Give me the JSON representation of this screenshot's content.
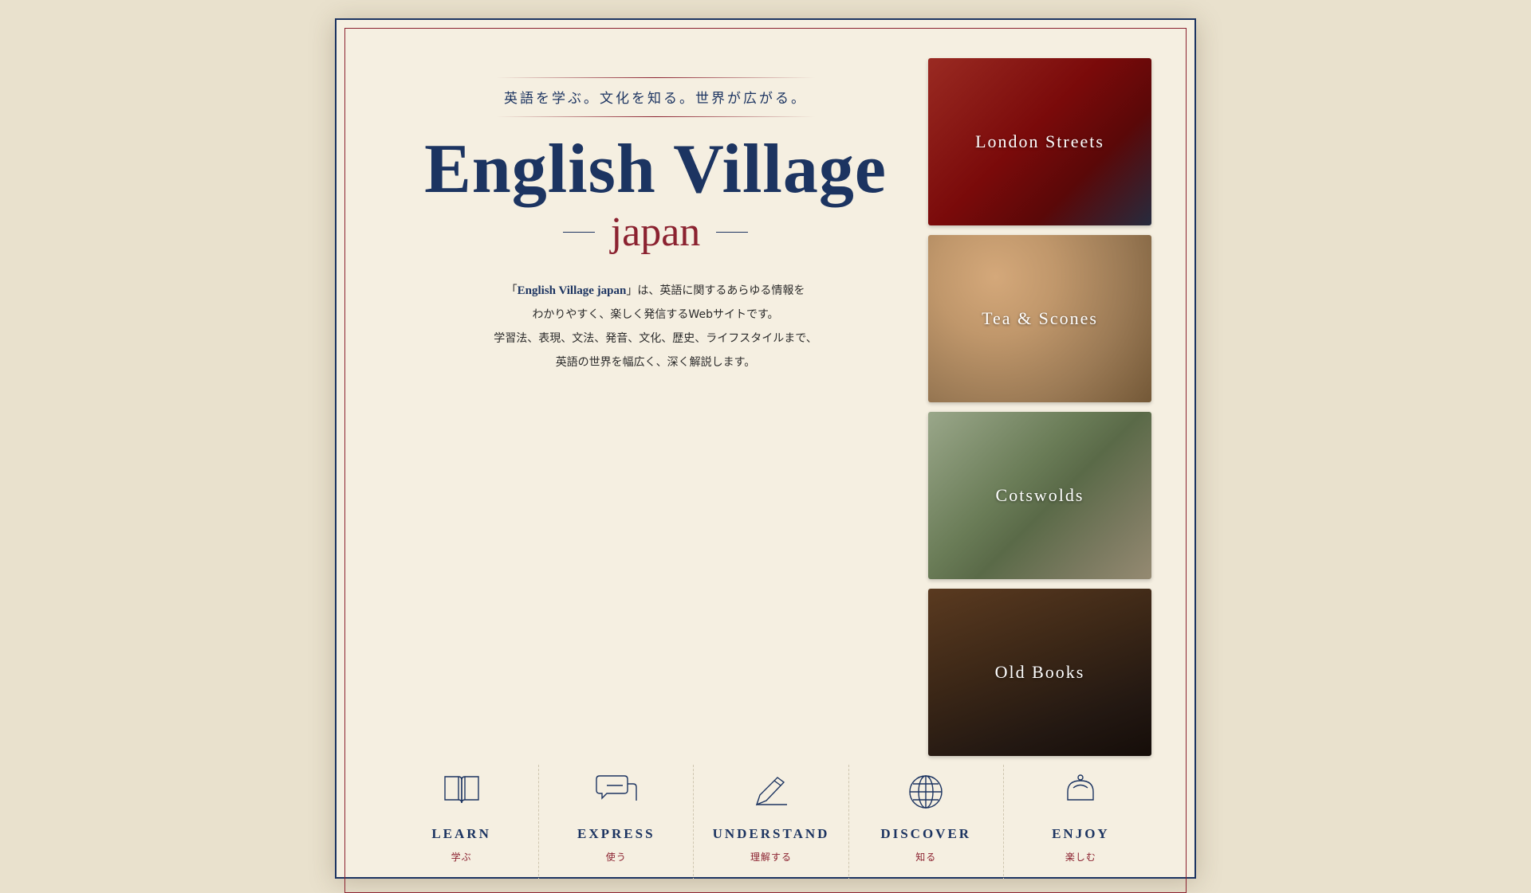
{
  "hero": {
    "tagline": "英語を学ぶ。文化を知る。世界が広がる。",
    "title": "English Village",
    "subtitle": "japan",
    "intro": {
      "open_quote": "「",
      "brand": "English Village japan",
      "line1_rest": "」は、英語に関するあらゆる情報を",
      "line2": "わかりやすく、楽しく発信するWebサイトです。",
      "line3": "学習法、表現、文法、発音、文化、歴史、ライフスタイルまで、",
      "line4": "英語の世界を幅広く、深く解説します。"
    }
  },
  "cards": [
    {
      "label": "London Streets"
    },
    {
      "label": "Tea & Scones"
    },
    {
      "label": "Cotswolds"
    },
    {
      "label": "Old Books"
    }
  ],
  "features": [
    {
      "label": "LEARN",
      "sub": "学ぶ",
      "icon": "book-icon"
    },
    {
      "label": "EXPRESS",
      "sub": "使う",
      "icon": "speech-bubble-icon"
    },
    {
      "label": "UNDERSTAND",
      "sub": "理解する",
      "icon": "pen-icon"
    },
    {
      "label": "DISCOVER",
      "sub": "知る",
      "icon": "globe-icon"
    },
    {
      "label": "ENJOY",
      "sub": "楽しむ",
      "icon": "tea-service-icon"
    }
  ],
  "colors": {
    "navy": "#1c3461",
    "burgundy": "#8b2230",
    "paper": "#f5efe1",
    "background": "#e9e1cd"
  }
}
